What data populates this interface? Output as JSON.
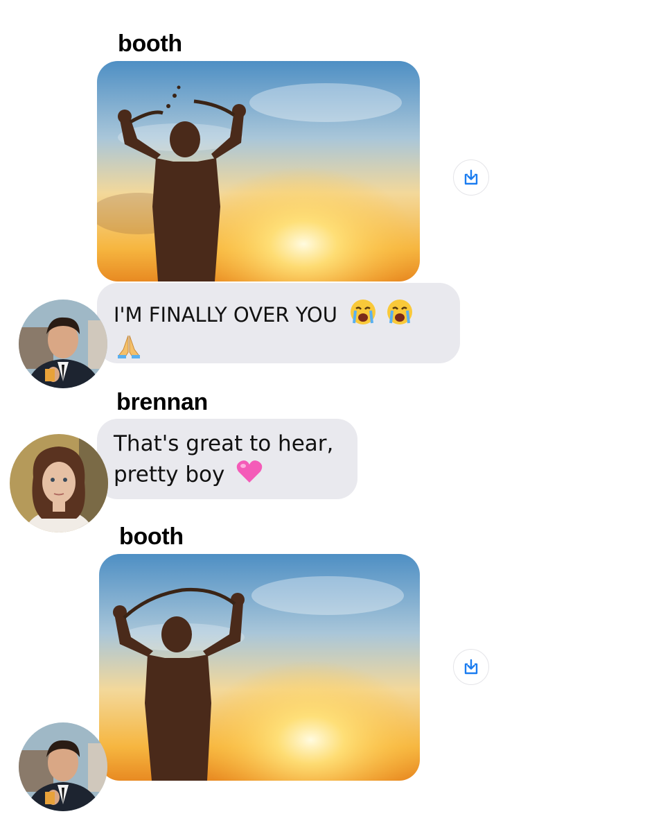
{
  "messages": [
    {
      "sender": "booth",
      "type": "image",
      "image_alt": "silhouette breaking chains at sunset",
      "action_icon": "save-to-device-icon"
    },
    {
      "sender": "booth",
      "type": "text",
      "text": "I'M FINALLY OVER YOU",
      "emojis": [
        "loudly-crying-face",
        "loudly-crying-face",
        "folded-hands"
      ]
    },
    {
      "sender": "brennan",
      "type": "text",
      "line1": "That's great to hear,",
      "line2": "pretty boy",
      "emojis": [
        "pink-heart"
      ]
    },
    {
      "sender": "booth",
      "type": "image",
      "image_alt": "silhouette breaking chains at sunset",
      "action_icon": "save-to-device-icon"
    }
  ],
  "colors": {
    "bubble": "#e9e9ee",
    "accent": "#1a7cf0",
    "text": "#111111"
  }
}
